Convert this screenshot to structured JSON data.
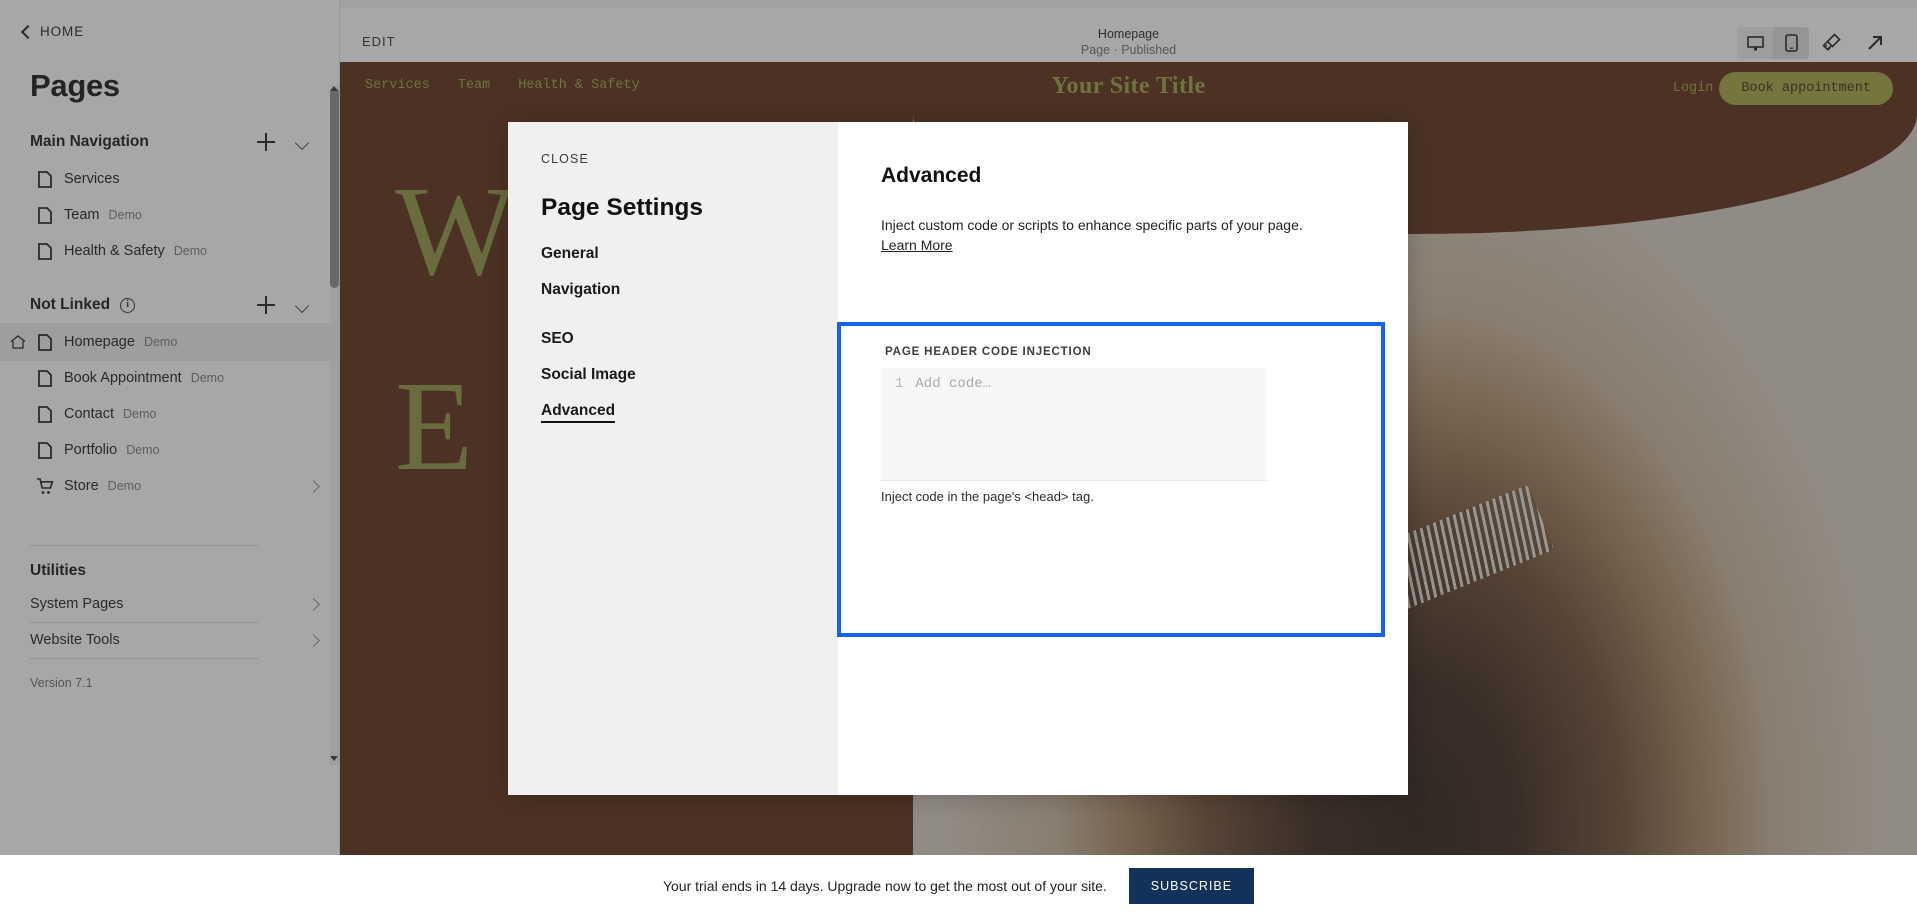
{
  "sidebar": {
    "back_label": "HOME",
    "title": "Pages",
    "sections": [
      {
        "heading": "Main Navigation",
        "items": [
          {
            "label": "Services",
            "badge": "",
            "icon": "document-icon"
          },
          {
            "label": "Team",
            "badge": "Demo",
            "icon": "document-icon"
          },
          {
            "label": "Health & Safety",
            "badge": "Demo",
            "icon": "document-icon"
          }
        ]
      },
      {
        "heading": "Not Linked",
        "items": [
          {
            "label": "Homepage",
            "badge": "Demo",
            "icon": "document-icon",
            "home": true,
            "active": true
          },
          {
            "label": "Book Appointment",
            "badge": "Demo",
            "icon": "document-icon"
          },
          {
            "label": "Contact",
            "badge": "Demo",
            "icon": "document-icon"
          },
          {
            "label": "Portfolio",
            "badge": "Demo",
            "icon": "document-icon"
          },
          {
            "label": "Store",
            "badge": "Demo",
            "icon": "cart-icon",
            "chevron": true
          }
        ]
      }
    ],
    "utilities_heading": "Utilities",
    "utilities": [
      {
        "label": "System Pages"
      },
      {
        "label": "Website Tools"
      }
    ],
    "version": "Version 7.1"
  },
  "topbar": {
    "edit_label": "EDIT",
    "page_name": "Homepage",
    "page_status": "Page · Published",
    "icons": {
      "desktop": "desktop-icon",
      "mobile": "mobile-icon",
      "brush": "paintbrush-icon",
      "open": "open-external-icon"
    }
  },
  "site_preview": {
    "nav_links": [
      "Services",
      "Team",
      "Health & Safety"
    ],
    "title": "Your Site Title",
    "login_label": "Login",
    "book_label": "Book appointment",
    "hero_line1": "W",
    "hero_line2": "E",
    "bg_color": "#5a2a13",
    "accent_color": "#9aa040"
  },
  "modal": {
    "close_label": "CLOSE",
    "title": "Page Settings",
    "nav": [
      {
        "label": "General",
        "selected": false
      },
      {
        "label": "Navigation",
        "selected": false
      },
      {
        "label": "SEO",
        "selected": false
      },
      {
        "label": "Social Image",
        "selected": false
      },
      {
        "label": "Advanced",
        "selected": true
      }
    ],
    "panel": {
      "heading": "Advanced",
      "description": "Inject custom code or scripts to enhance specific parts of your page.",
      "learn_more": "Learn More",
      "injection_label": "PAGE HEADER CODE INJECTION",
      "code_line_number": "1",
      "code_placeholder": "Add code…",
      "code_value": "",
      "help_text": "Inject code in the page's <head> tag.",
      "focus_color": "#1763e8"
    }
  },
  "banner": {
    "message": "Your trial ends in 14 days. Upgrade now to get the most out of your site.",
    "cta": "SUBSCRIBE",
    "cta_color": "#12325b"
  }
}
